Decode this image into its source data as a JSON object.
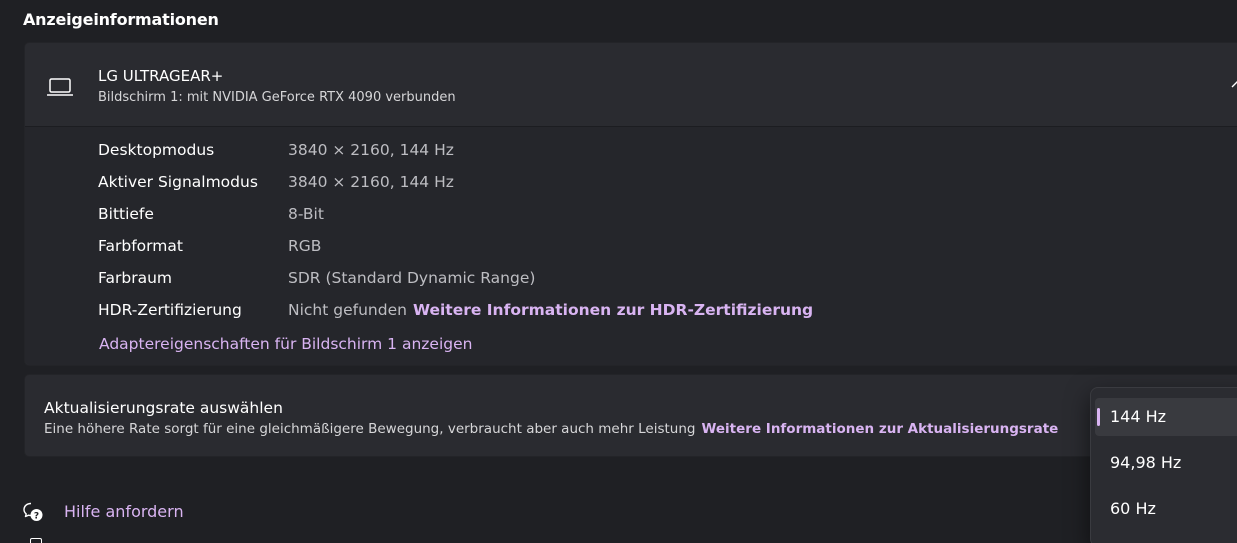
{
  "section": {
    "heading": "Anzeigeinformationen"
  },
  "display": {
    "name": "LG ULTRAGEAR+",
    "subtitle": "Bildschirm 1: mit NVIDIA GeForce RTX 4090 verbunden",
    "icon": "laptop-icon",
    "rows": [
      {
        "label": "Desktopmodus",
        "value": "3840 × 2160, 144 Hz"
      },
      {
        "label": "Aktiver Signalmodus",
        "value": "3840 × 2160, 144 Hz"
      },
      {
        "label": "Bittiefe",
        "value": "8-Bit"
      },
      {
        "label": "Farbformat",
        "value": "RGB"
      },
      {
        "label": "Farbraum",
        "value": "SDR (Standard Dynamic Range)"
      },
      {
        "label": "HDR-Zertifizierung",
        "value": "Nicht gefunden",
        "link": "Weitere Informationen zur HDR-Zertifizierung"
      }
    ],
    "adapter_link": "Adaptereigenschaften für Bildschirm 1 anzeigen"
  },
  "refresh": {
    "title": "Aktualisierungsrate auswählen",
    "description": "Eine höhere Rate sorgt für eine gleichmäßigere Bewegung, verbraucht aber auch mehr Leistung",
    "link": "Weitere Informationen zur Aktualisierungsrate",
    "options": [
      "144 Hz",
      "94,98 Hz",
      "60 Hz"
    ],
    "selected": "144 Hz"
  },
  "help": {
    "label": "Hilfe anfordern",
    "icon": "help-chat-icon"
  },
  "colors": {
    "accent": "#d9b4f2",
    "background": "#1f2024",
    "card": "#2a2b30"
  }
}
